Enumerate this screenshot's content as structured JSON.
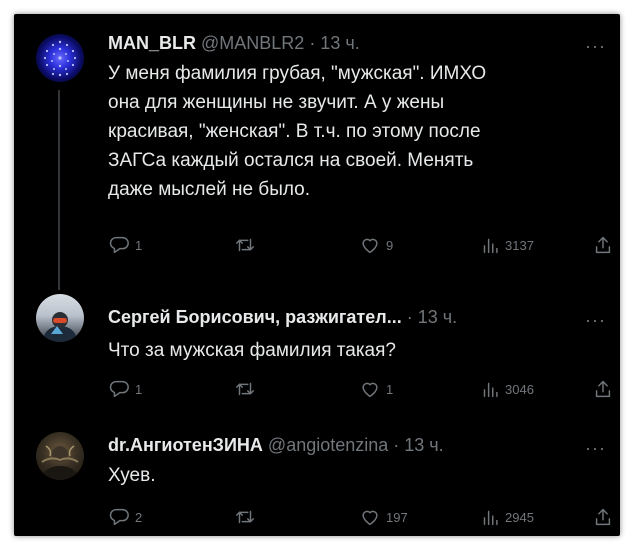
{
  "tweets": [
    {
      "author_name": "MAN_BLR",
      "handle_time": "@MANBLR2 · 13 ч.",
      "more": "···",
      "text": "У меня фамилия грубая, \"мужская\". ИМХО\nона для женщины не звучит. А у жены\nкрасивая, \"женская\". В т.ч. по этому после\nЗАГСа каждый остался на своей. Менять\nдаже мыслей не было.",
      "replies": "1",
      "retweets": "",
      "likes": "9",
      "views": "3137"
    },
    {
      "author_name": "Сергей Борисович, разжигател...",
      "handle_time": "· 13 ч.",
      "more": "···",
      "text": "Что за мужская фамилия такая?",
      "replies": "1",
      "retweets": "",
      "likes": "1",
      "views": "3046"
    },
    {
      "author_name": "dr.АнгиотенЗИНА",
      "handle_time": "@angiotenzina · 13 ч.",
      "more": "···",
      "text": "Хуев.",
      "replies": "2",
      "retweets": "",
      "likes": "197",
      "views": "2945"
    }
  ],
  "colors": {
    "background": "#000000",
    "text": "#e7e9ea",
    "muted": "#71767b",
    "thread_line": "#333639"
  },
  "icons": [
    "reply-icon",
    "retweet-icon",
    "like-icon",
    "views-icon",
    "share-icon",
    "more-icon"
  ]
}
